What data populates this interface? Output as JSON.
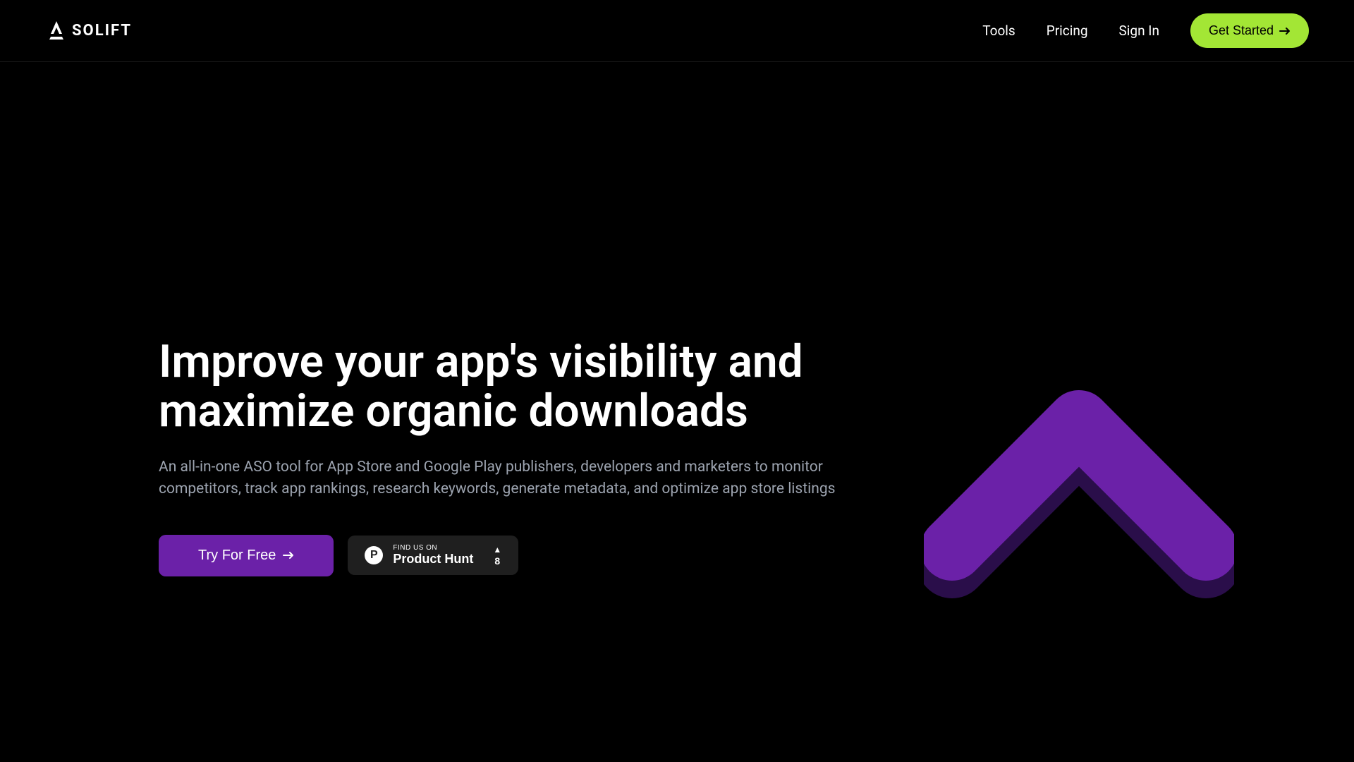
{
  "header": {
    "logo_text": "SOLIFT",
    "nav": {
      "tools": "Tools",
      "pricing": "Pricing",
      "signin": "Sign In",
      "get_started": "Get Started"
    }
  },
  "hero": {
    "title": "Improve your app's visibility and maximize organic downloads",
    "subtitle": "An all-in-one ASO tool for App Store and Google Play publishers, developers and marketers to monitor competitors, track app rankings, research keywords, generate metadata, and optimize app store listings",
    "try_free": "Try For Free",
    "product_hunt": {
      "find_us": "FIND US ON",
      "name": "Product Hunt",
      "votes": "8"
    }
  }
}
